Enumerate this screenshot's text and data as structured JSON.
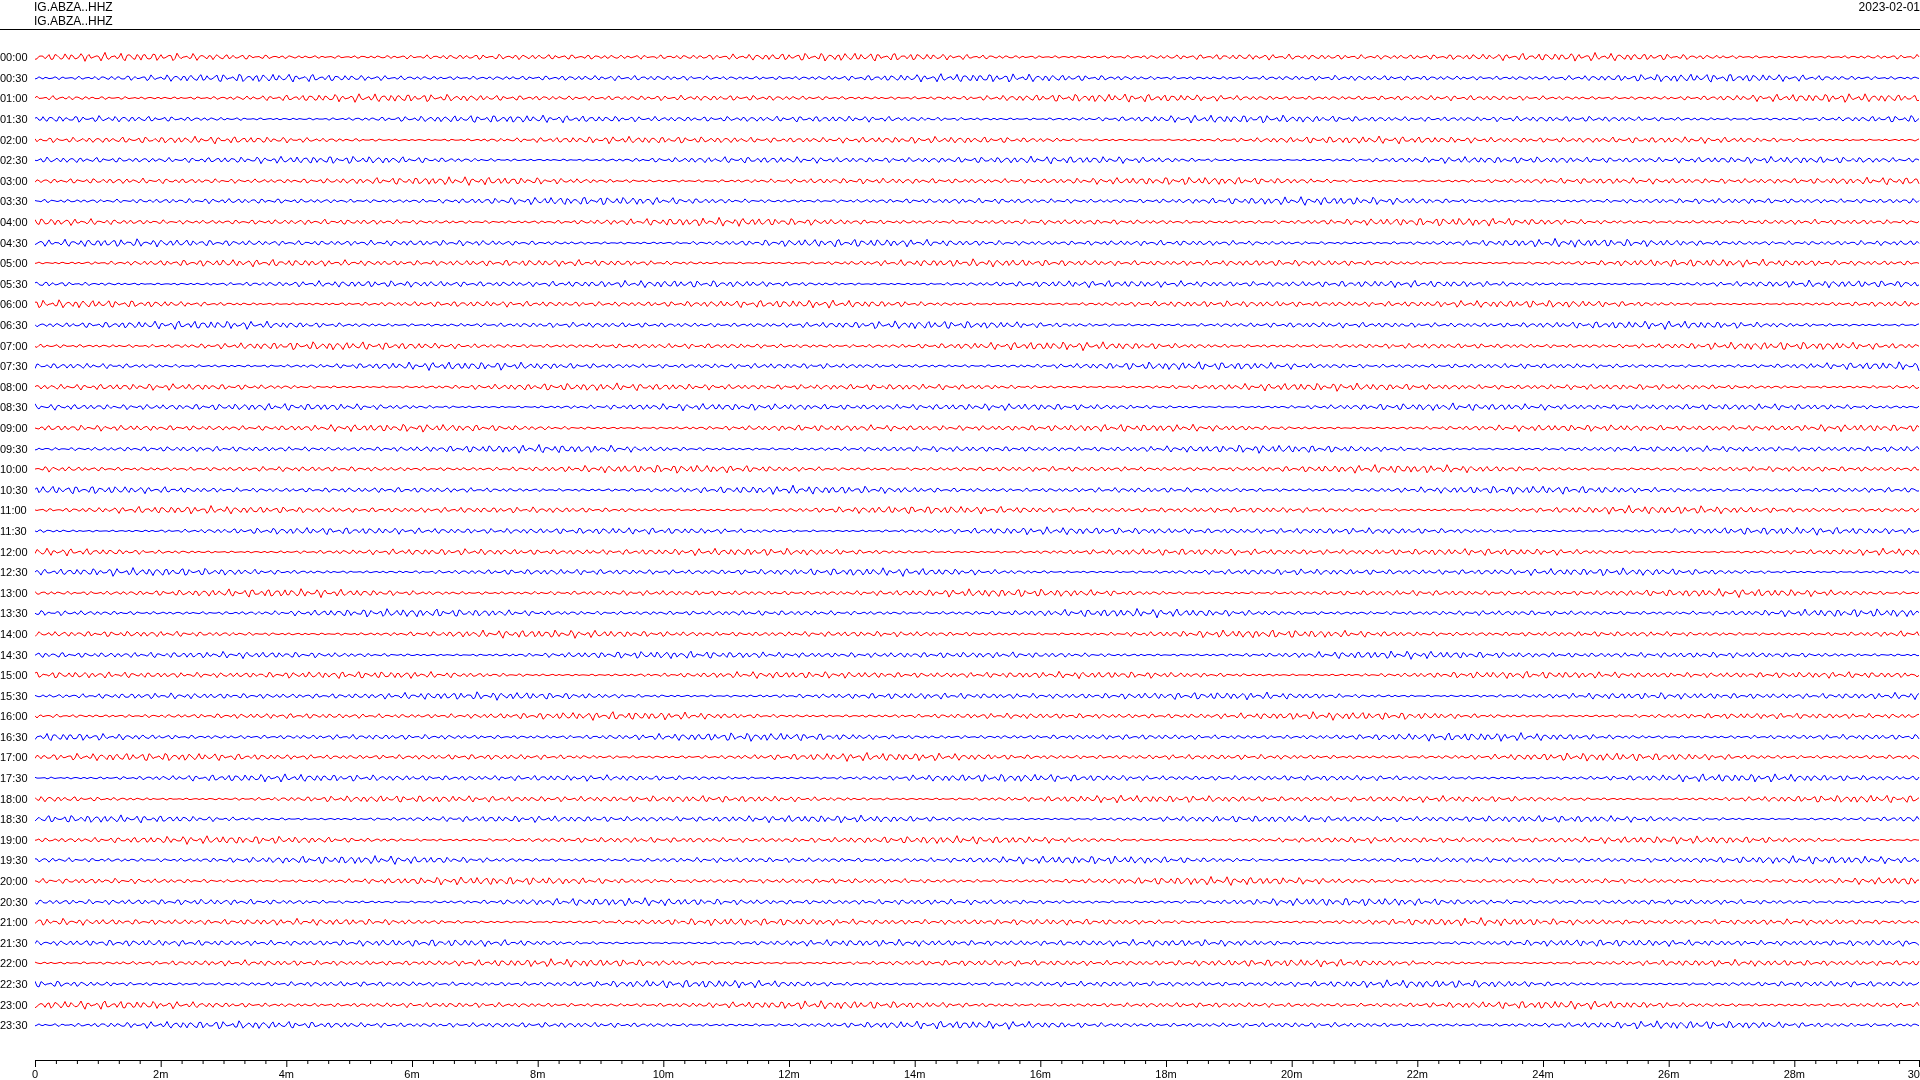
{
  "header": {
    "station_lines": [
      "IG.ABZA..HHZ",
      "IG.ABZA..HHZ"
    ],
    "date": "2023-02-01"
  },
  "rows": [
    {
      "label": "00:00",
      "color": "#ff0000"
    },
    {
      "label": "00:30",
      "color": "#0000ff"
    },
    {
      "label": "01:00",
      "color": "#ff0000"
    },
    {
      "label": "01:30",
      "color": "#0000ff"
    },
    {
      "label": "02:00",
      "color": "#ff0000"
    },
    {
      "label": "02:30",
      "color": "#0000ff"
    },
    {
      "label": "03:00",
      "color": "#ff0000"
    },
    {
      "label": "03:30",
      "color": "#0000ff"
    },
    {
      "label": "04:00",
      "color": "#ff0000"
    },
    {
      "label": "04:30",
      "color": "#0000ff"
    },
    {
      "label": "05:00",
      "color": "#ff0000"
    },
    {
      "label": "05:30",
      "color": "#0000ff"
    },
    {
      "label": "06:00",
      "color": "#ff0000"
    },
    {
      "label": "06:30",
      "color": "#0000ff"
    },
    {
      "label": "07:00",
      "color": "#ff0000"
    },
    {
      "label": "07:30",
      "color": "#0000ff"
    },
    {
      "label": "08:00",
      "color": "#ff0000"
    },
    {
      "label": "08:30",
      "color": "#0000ff"
    },
    {
      "label": "09:00",
      "color": "#ff0000"
    },
    {
      "label": "09:30",
      "color": "#0000ff"
    },
    {
      "label": "10:00",
      "color": "#ff0000"
    },
    {
      "label": "10:30",
      "color": "#0000ff"
    },
    {
      "label": "11:00",
      "color": "#ff0000"
    },
    {
      "label": "11:30",
      "color": "#0000ff"
    },
    {
      "label": "12:00",
      "color": "#ff0000"
    },
    {
      "label": "12:30",
      "color": "#0000ff"
    },
    {
      "label": "13:00",
      "color": "#ff0000"
    },
    {
      "label": "13:30",
      "color": "#0000ff"
    },
    {
      "label": "14:00",
      "color": "#ff0000"
    },
    {
      "label": "14:30",
      "color": "#0000ff"
    },
    {
      "label": "15:00",
      "color": "#ff0000"
    },
    {
      "label": "15:30",
      "color": "#0000ff"
    },
    {
      "label": "16:00",
      "color": "#ff0000"
    },
    {
      "label": "16:30",
      "color": "#0000ff"
    },
    {
      "label": "17:00",
      "color": "#ff0000"
    },
    {
      "label": "17:30",
      "color": "#0000ff"
    },
    {
      "label": "18:00",
      "color": "#ff0000"
    },
    {
      "label": "18:30",
      "color": "#0000ff"
    },
    {
      "label": "19:00",
      "color": "#ff0000"
    },
    {
      "label": "19:30",
      "color": "#0000ff"
    },
    {
      "label": "20:00",
      "color": "#ff0000"
    },
    {
      "label": "20:30",
      "color": "#0000ff"
    },
    {
      "label": "21:00",
      "color": "#ff0000"
    },
    {
      "label": "21:30",
      "color": "#0000ff"
    },
    {
      "label": "22:00",
      "color": "#ff0000"
    },
    {
      "label": "22:30",
      "color": "#0000ff"
    },
    {
      "label": "23:00",
      "color": "#ff0000"
    },
    {
      "label": "23:30",
      "color": "#0000ff"
    }
  ],
  "x_axis": {
    "labels": [
      "0",
      "2m",
      "4m",
      "6m",
      "8m",
      "10m",
      "12m",
      "14m",
      "16m",
      "18m",
      "20m",
      "22m",
      "24m",
      "26m",
      "28m",
      "30"
    ]
  }
}
